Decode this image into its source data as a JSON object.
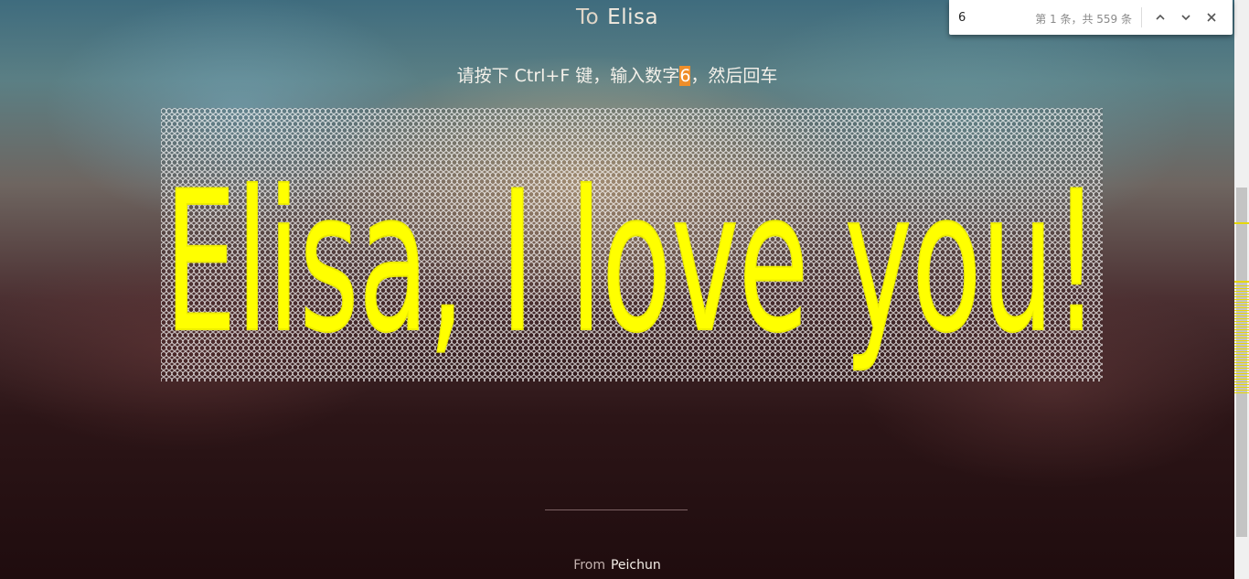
{
  "header": {
    "to_label": "To",
    "recipient": "Elisa"
  },
  "instruction": {
    "before": "请按下 Ctrl+F 键，输入数字",
    "highlight": "6",
    "after": "，然后回车"
  },
  "grid": {
    "fill_char": "9",
    "match_char": "6",
    "message": "Elisa, I love you!"
  },
  "footer": {
    "from_label": "From",
    "sender": "Peichun"
  },
  "find_bar": {
    "query": "6",
    "count_text": "第 1 条，共 559 条"
  },
  "icons": {
    "previous": "chevron-up-icon",
    "next": "chevron-down-icon",
    "close": "close-icon"
  },
  "colors": {
    "match_yellow": "#ffff00",
    "current_match_orange": "#ef8e2a",
    "scroll_marker": "#e6d80a"
  }
}
